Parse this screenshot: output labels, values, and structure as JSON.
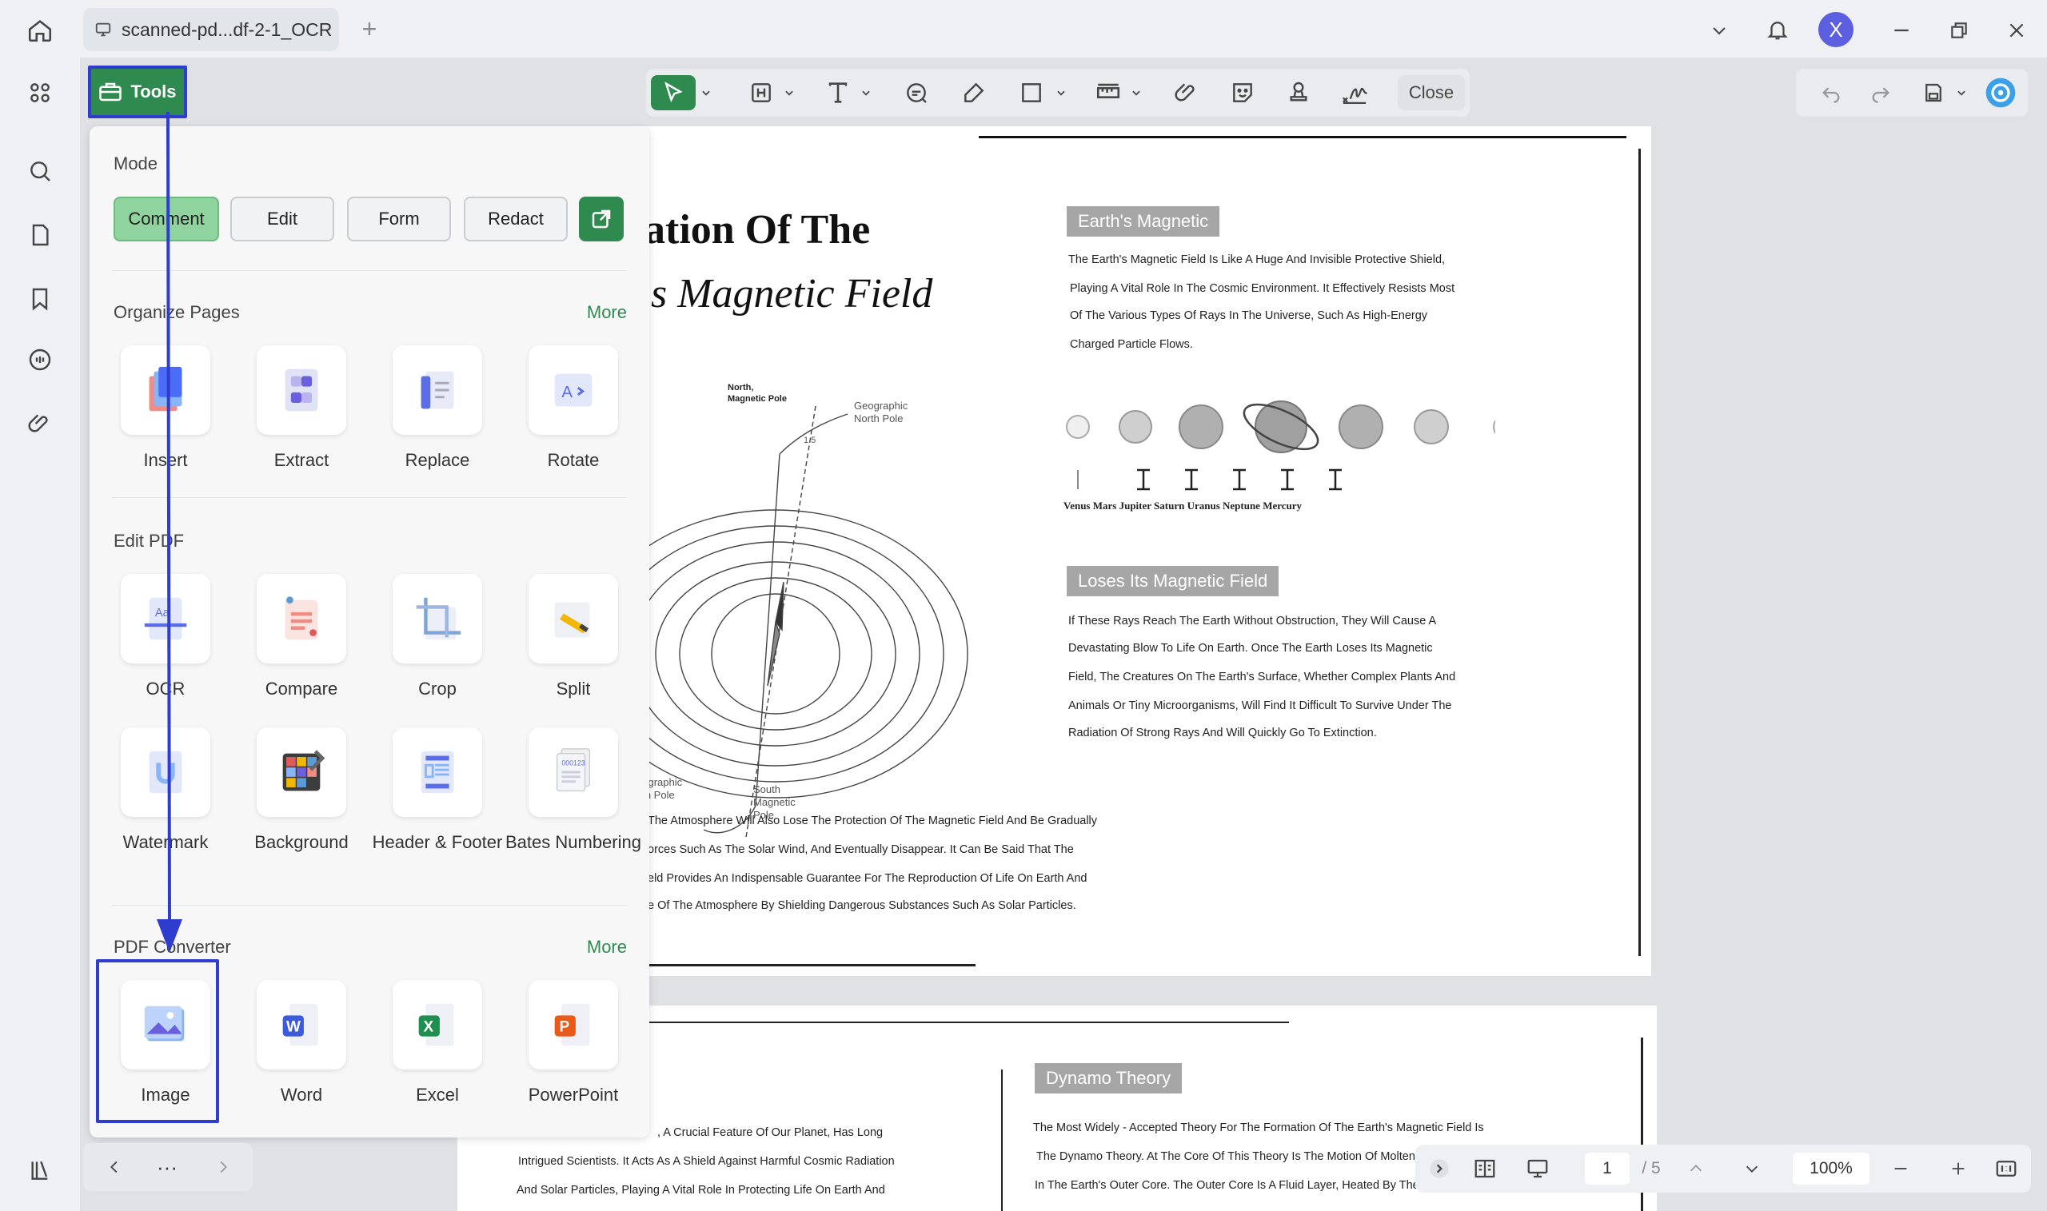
{
  "tab": {
    "title": "scanned-pd...df-2-1_OCR",
    "new_tab": "+"
  },
  "user": {
    "avatar_letter": "X"
  },
  "tools_button": "Tools",
  "toolbar": {
    "close_label": "Close"
  },
  "panel": {
    "mode_title": "Mode",
    "modes": [
      "Comment",
      "Edit",
      "Form",
      "Redact"
    ],
    "active_mode": "Comment",
    "organize_title": "Organize Pages",
    "organize_more": "More",
    "organize_items": [
      "Insert",
      "Extract",
      "Replace",
      "Rotate"
    ],
    "edit_title": "Edit PDF",
    "edit_items": [
      "OCR",
      "Compare",
      "Crop",
      "Split",
      "Watermark",
      "Background",
      "Header & Footer",
      "Bates Numbering"
    ],
    "converter_title": "PDF Converter",
    "converter_more": "More",
    "converter_items": [
      "Image",
      "Word",
      "Excel",
      "PowerPoint"
    ]
  },
  "document": {
    "heading1": "ation Of The",
    "heading2": "s Magnetic Field",
    "box1": "Earth's Magnetic",
    "p1": [
      "The Earth's Magnetic Field Is Like A Huge And Invisible Protective Shield,",
      "Playing A Vital Role In The Cosmic Environment. It Effectively Resists Most",
      "Of The Various Types Of Rays In The Universe, Such As High-Energy",
      "Charged Particle Flows."
    ],
    "planets": "Venus Mars Jupiter Saturn Uranus Neptune Mercury",
    "box2": "Loses Its Magnetic Field",
    "p2": [
      "If These Rays Reach The Earth Without Obstruction, They Will Cause A",
      "Devastating Blow To Life On Earth. Once The Earth Loses Its Magnetic",
      "Field, The Creatures On The Earth's Surface, Whether Complex Plants And",
      "Animals Or Tiny Microorganisms, Will Find It Difficult To Survive Under The",
      "Radiation Of Strong Rays And Will Quickly Go To Extinction."
    ],
    "diagram_labels": {
      "north": "North, Magnetic Pole",
      "geo_north": "Geographic North Pole",
      "angle": "1.5",
      "geo_south": "eographic uth Pole",
      "south": "South Magnetic Pole"
    },
    "p3": [
      "The Atmosphere Will Also Lose The Protection Of The Magnetic Field And Be Gradually",
      "orces Such As The Solar Wind, And Eventually Disappear. It Can Be Said That The",
      "eld Provides An Indispensable Guarantee For The Reproduction Of Life On Earth And",
      "e Of The Atmosphere By Shielding Dangerous Substances Such As Solar Particles."
    ],
    "box3": "Dynamo Theory",
    "p4_left": [
      ", A Crucial Feature Of Our Planet, Has Long",
      "Intrigued Scientists. It Acts As A Shield Against Harmful Cosmic Radiation",
      "And Solar Particles, Playing A Vital Role In Protecting Life On Earth And"
    ],
    "p4_right": [
      "The Most Widely - Accepted Theory For The Formation Of The Earth's Magnetic Field Is",
      "The Dynamo Theory. At The Core Of This Theory Is The Motion Of Molten I",
      "In The Earth's Outer Core. The Outer Core Is A Fluid Layer, Heated By The"
    ]
  },
  "status": {
    "page_current": "1",
    "page_total": "/ 5",
    "zoom": "100%"
  },
  "colors": {
    "accent": "#2e8a4f",
    "highlight": "#2f3dcf"
  }
}
